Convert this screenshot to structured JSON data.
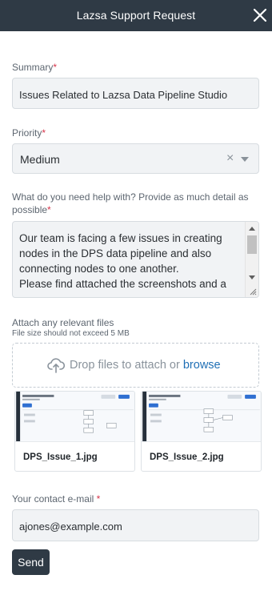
{
  "header": {
    "title": "Lazsa Support Request",
    "close_icon": "close-icon"
  },
  "form": {
    "summary": {
      "label": "Summary",
      "required_mark": "*",
      "value": "Issues Related to Lazsa Data Pipeline Studio"
    },
    "priority": {
      "label": "Priority",
      "required_mark": "*",
      "value": "Medium",
      "clear_glyph": "×"
    },
    "help": {
      "label": "What do you need help with? Provide as much detail as possible",
      "required_mark": "*",
      "value": "Our team is facing a few issues in creating nodes in the DPS data pipeline and also connecting nodes to one another.\nPlease find attached the screenshots and a"
    },
    "attachments": {
      "label": "Attach any relevant files",
      "note": "File size should not exceed 5 MB",
      "drop_text": "Drop files to attach or",
      "browse_label": "browse",
      "files": [
        {
          "name": "DPS_Issue_1.jpg"
        },
        {
          "name": "DPS_Issue_2.jpg"
        }
      ]
    },
    "email": {
      "label": "Your contact e-mail",
      "required_mark": "*",
      "value": "ajones@example.com"
    },
    "send_label": "Send"
  },
  "colors": {
    "header_bg": "#2f3a45",
    "required": "#d6344a",
    "link": "#1f6fb5",
    "field_bg": "#f1f3f5"
  }
}
